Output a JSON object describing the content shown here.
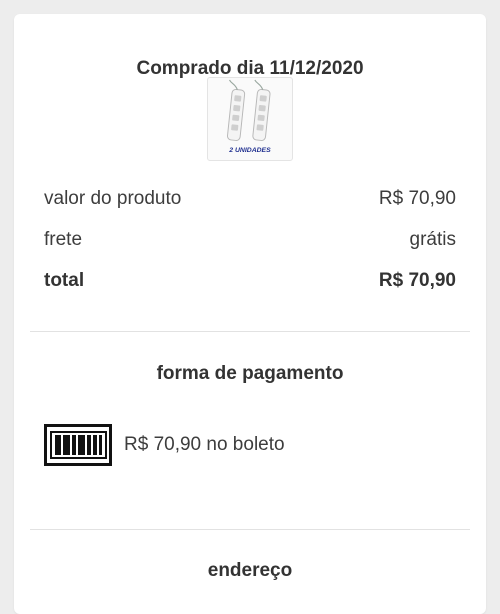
{
  "purchase": {
    "title": "Comprado dia 11/12/2020",
    "product_image_caption": "2 UNIDADES"
  },
  "summary": {
    "product_value_label": "valor do produto",
    "product_value": "R$ 70,90",
    "shipping_label": "frete",
    "shipping_value": "grátis",
    "total_label": "total",
    "total_value": "R$ 70,90"
  },
  "payment": {
    "section_title": "forma de pagamento",
    "method_text": "R$ 70,90 no boleto",
    "icon": "barcode-boleto-icon"
  },
  "address": {
    "section_title": "endereço"
  },
  "colors": {
    "background": "#ededed",
    "card": "#ffffff",
    "text": "#3d3d3d",
    "divider": "#e2e2e2",
    "caption_blue": "#1f2f8f"
  }
}
